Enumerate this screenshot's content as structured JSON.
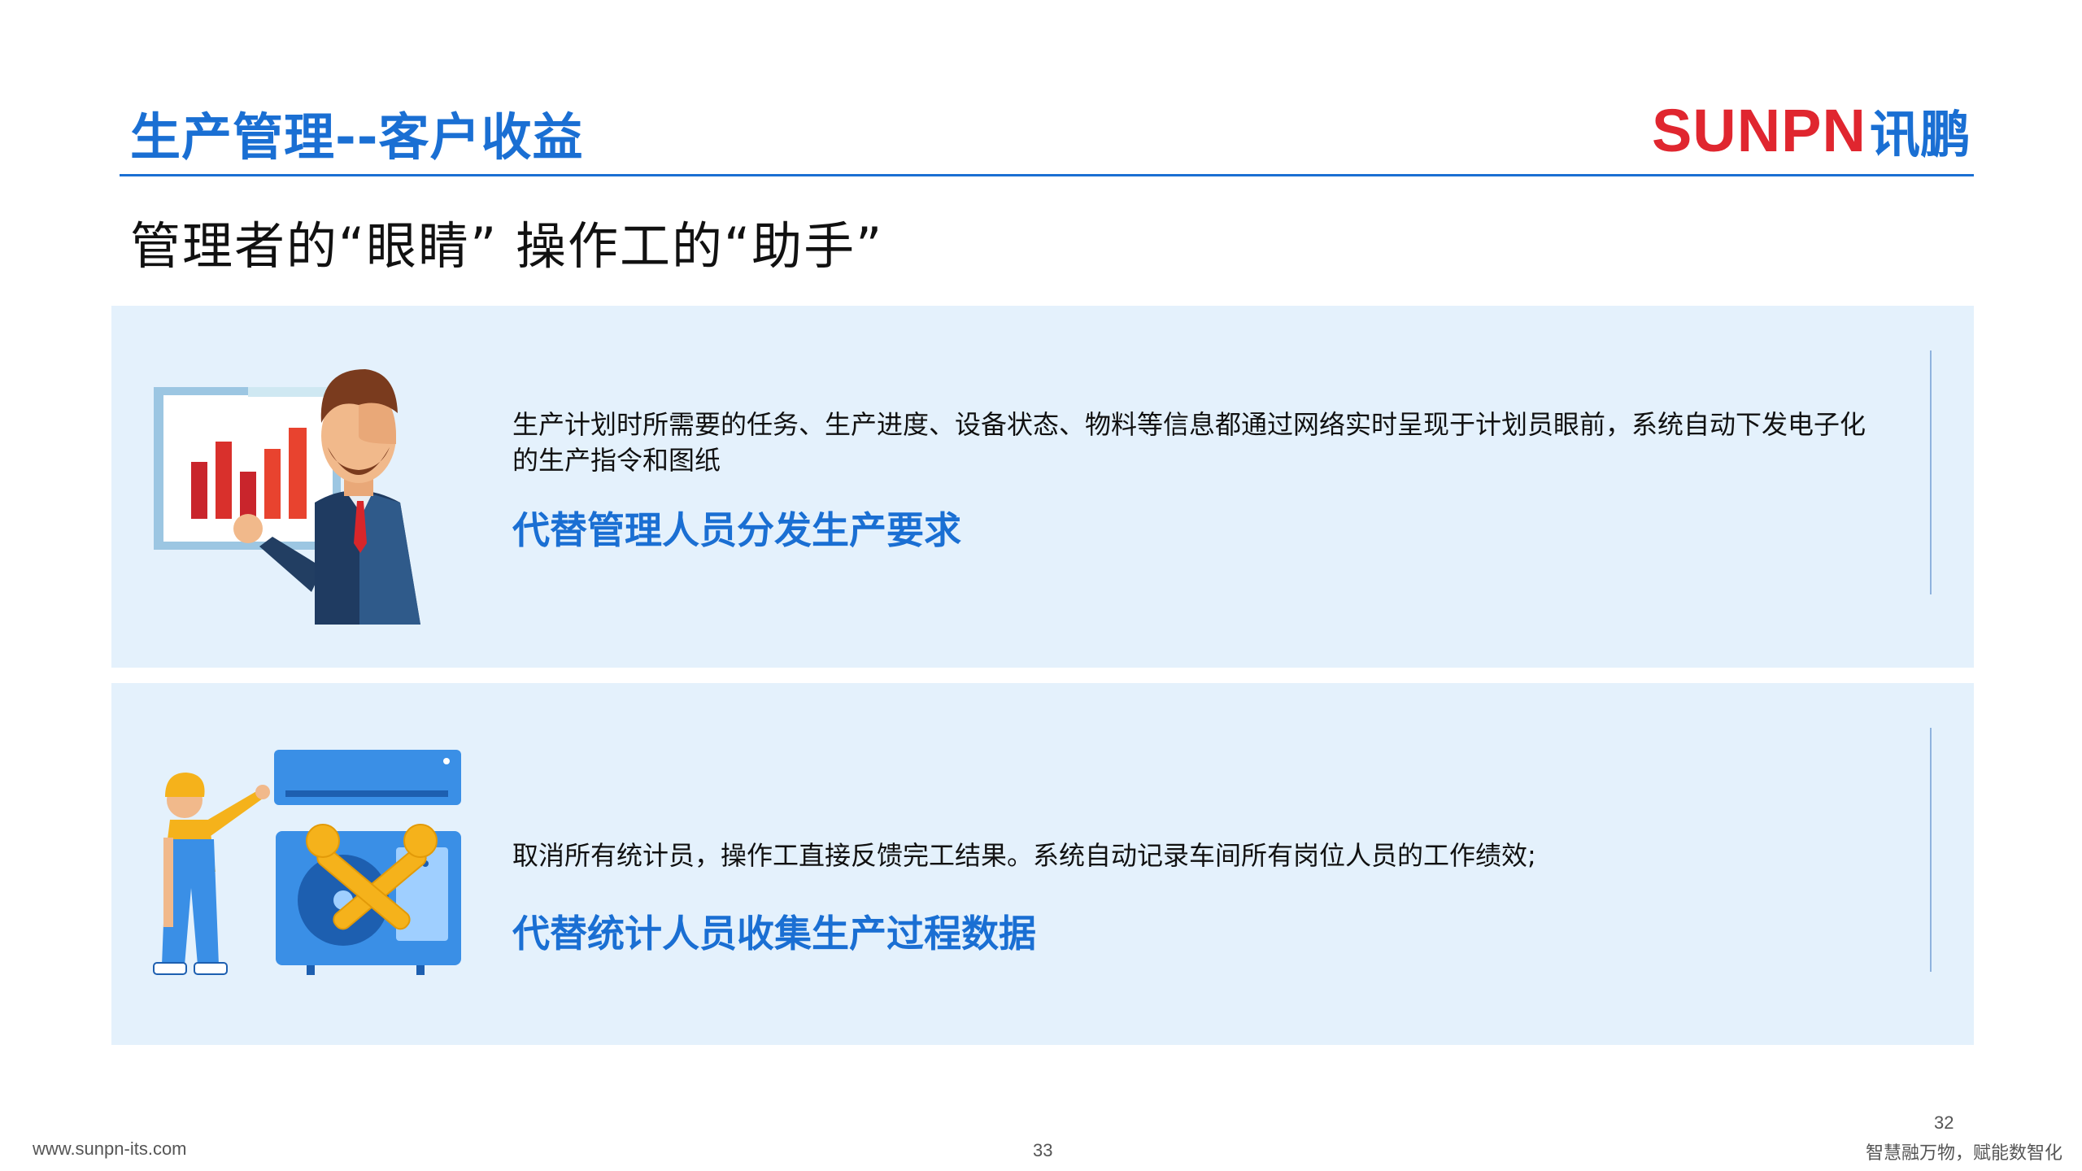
{
  "header": {
    "title": "生产管理--客户收益",
    "brand_en": "SUNPN",
    "brand_cn": "讯鹏",
    "subtitle": "管理者的“眼睛” 操作工的“助手”"
  },
  "panels": [
    {
      "icon": "presenter-chart-illustration",
      "description": "生产计划时所需要的任务、生产进度、设备状态、物料等信息都通过网络实时呈现于计划员眼前，系统自动下发电子化的生产指令和图纸",
      "highlight": "代替管理人员分发生产要求"
    },
    {
      "icon": "worker-air-conditioner-repair-illustration",
      "description": "取消所有统计员，操作工直接反馈完工结果。系统自动记录车间所有岗位人员的工作绩效;",
      "highlight": "代替统计人员收集生产过程数据"
    }
  ],
  "footer": {
    "url": "www.sunpn-its.com",
    "page_number": "33",
    "page_number_alt": "32",
    "slogan": "智慧融万物，赋能数智化"
  },
  "colors": {
    "accent_blue": "#1a6fd3",
    "brand_red": "#e0262f",
    "panel_bg": "#e4f1fc"
  }
}
